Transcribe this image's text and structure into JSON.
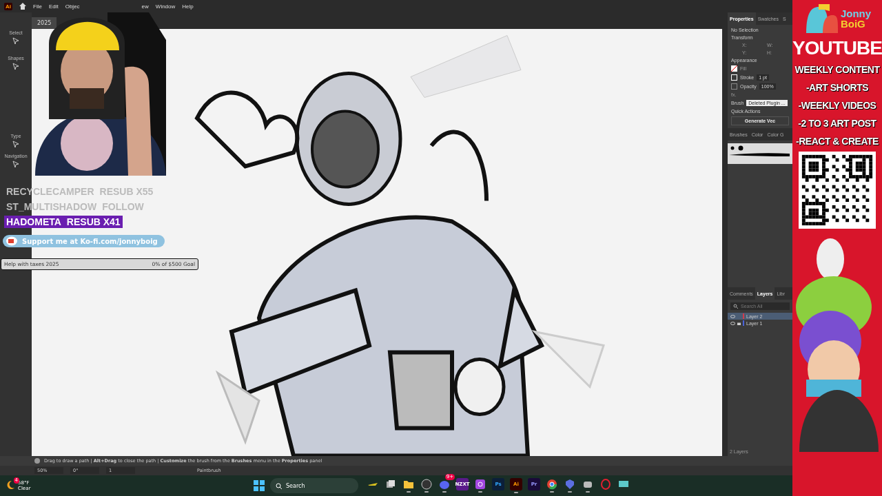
{
  "menu_bar": {
    "app_logo": "Ai",
    "items": [
      "File",
      "Edit",
      "Objec",
      "ew",
      "Window",
      "Help"
    ]
  },
  "document_tab": {
    "title": "2025"
  },
  "toolbar": {
    "sections": [
      "Select",
      "Shapes",
      "Type",
      "Navigation"
    ]
  },
  "properties_panel": {
    "tabs": [
      {
        "label": "Properties",
        "selected": true
      },
      {
        "label": "Swatches",
        "selected": false
      },
      {
        "label": "S",
        "selected": false
      }
    ],
    "selection": "No Selection",
    "transform_title": "Transform",
    "transform_fields": [
      "X:",
      "W:",
      "Y:",
      "H:"
    ],
    "appearance_title": "Appearance",
    "fill": "Fill",
    "stroke": "Stroke",
    "stroke_value": "1 pt",
    "opacity": "Opacity",
    "opacity_value": "100%",
    "fx": "fx.",
    "brush_label": "Brush",
    "brush_value": "Deleted Plugin ...",
    "quick_actions": "Quick Actions",
    "quick_button": "Generate Vec"
  },
  "brushes_panel": {
    "tabs": [
      "Brushes",
      "Color",
      "Color G"
    ]
  },
  "layers_panel": {
    "tabs": [
      {
        "label": "Comments",
        "selected": false
      },
      {
        "label": "Layers",
        "selected": true
      },
      {
        "label": "Libr",
        "selected": false
      }
    ],
    "search_placeholder": "Search All",
    "layers": [
      {
        "name": "Layer 2",
        "selected": true,
        "locked": false,
        "color": "#d23b4b"
      },
      {
        "name": "Layer 1",
        "selected": false,
        "locked": true,
        "color": "#4a62d8"
      }
    ],
    "count": "2 Layers"
  },
  "status_hint": "Drag to draw a path  |  **Alt+Drag** to close the path  |  **Customize** the brush from the **Brushes** menu in the **Properties** panel",
  "bottom_bar": {
    "zoom": "50%",
    "rotation": "0°",
    "artboard": "1",
    "tool": "Paintbrush"
  },
  "stream_overlay": {
    "alerts": [
      {
        "name": "RECYCLECAMPER",
        "event": "RESUB X55",
        "kind": "faded"
      },
      {
        "name": "ST_MULTISHADOW",
        "event": "FOLLOW",
        "kind": "faded"
      },
      {
        "name": "HADOMETA",
        "event": "RESUB X41",
        "kind": "highlight"
      }
    ],
    "kofi": "Support me at Ko-fi.com/jonnyboig",
    "goal": {
      "title": "Help with taxes 2025",
      "progress": "0% of $500 Goal",
      "level": 0
    }
  },
  "promo_panel": {
    "logo": [
      "Jonny",
      "BoiG"
    ],
    "title": "YOUTUBE",
    "lines": [
      "WEEKLY CONTENT",
      "-ART SHORTS",
      "-WEEKLY VIDEOS",
      "-2 TO 3 ART POST",
      "-REACT & CREATE"
    ]
  },
  "taskbar": {
    "weather": {
      "temperature": "58°F",
      "condition": "Clear",
      "badge": "4"
    },
    "search": "Search",
    "apps": [
      {
        "kind": "plane",
        "running": false
      },
      {
        "kind": "taskview",
        "running": false
      },
      {
        "kind": "folder",
        "running": true
      },
      {
        "kind": "obs",
        "running": true
      },
      {
        "kind": "discord",
        "running": true,
        "badge": "9+"
      },
      {
        "kind": "nzxt",
        "text": "NZXT",
        "running": false
      },
      {
        "kind": "media",
        "running": true
      },
      {
        "kind": "ps",
        "text": "Ps",
        "running": false
      },
      {
        "kind": "ai",
        "text": "Ai",
        "running": true
      },
      {
        "kind": "pr",
        "text": "Pr",
        "running": false
      },
      {
        "kind": "chrome",
        "running": true
      },
      {
        "kind": "streamer",
        "running": true
      },
      {
        "kind": "bot",
        "running": true
      },
      {
        "kind": "opera",
        "running": false
      },
      {
        "kind": "monitor",
        "running": false
      }
    ]
  }
}
